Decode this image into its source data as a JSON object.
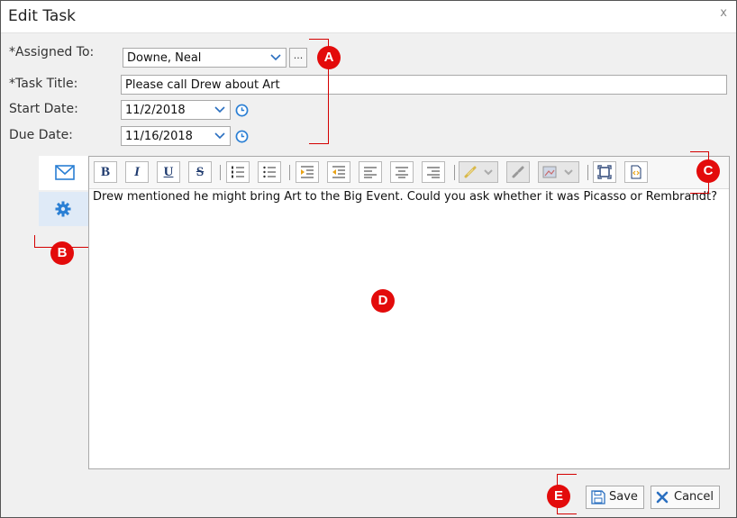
{
  "dialog": {
    "title": "Edit Task",
    "close_label": "x"
  },
  "form": {
    "assigned_to_label": "*Assigned To:",
    "assigned_to_value": "Downe, Neal",
    "browse_label": "...",
    "task_title_label": "*Task Title:",
    "task_title_value": "Please call Drew about Art",
    "start_date_label": "Start Date:",
    "start_date_value": "11/2/2018",
    "due_date_label": "Due Date:",
    "due_date_value": "11/16/2018"
  },
  "side_tabs": [
    {
      "name": "email-tab",
      "icon": "envelope-icon"
    },
    {
      "name": "settings-tab",
      "icon": "gear-icon",
      "active": true
    }
  ],
  "toolbar": {
    "bold": "B",
    "italic": "I",
    "underline": "U",
    "strike": "S",
    "tools": [
      "ordered-list",
      "unordered-list",
      "indent",
      "outdent",
      "align-left",
      "align-center",
      "align-right",
      "insert-link",
      "remove-link",
      "insert-image",
      "fullscreen",
      "view-html"
    ]
  },
  "editor": {
    "body_text": "Drew mentioned he might bring Art to the Big Event. Could you ask whether it was Picasso or Rembrandt?"
  },
  "footer": {
    "save_label": "Save",
    "cancel_label": "Cancel"
  },
  "callouts": {
    "a": "A",
    "b": "B",
    "c": "C",
    "d": "D",
    "e": "E"
  },
  "colors": {
    "callout": "#e30b0b",
    "accent": "#2a7fd4",
    "cancel_x": "#2a6fc0"
  }
}
